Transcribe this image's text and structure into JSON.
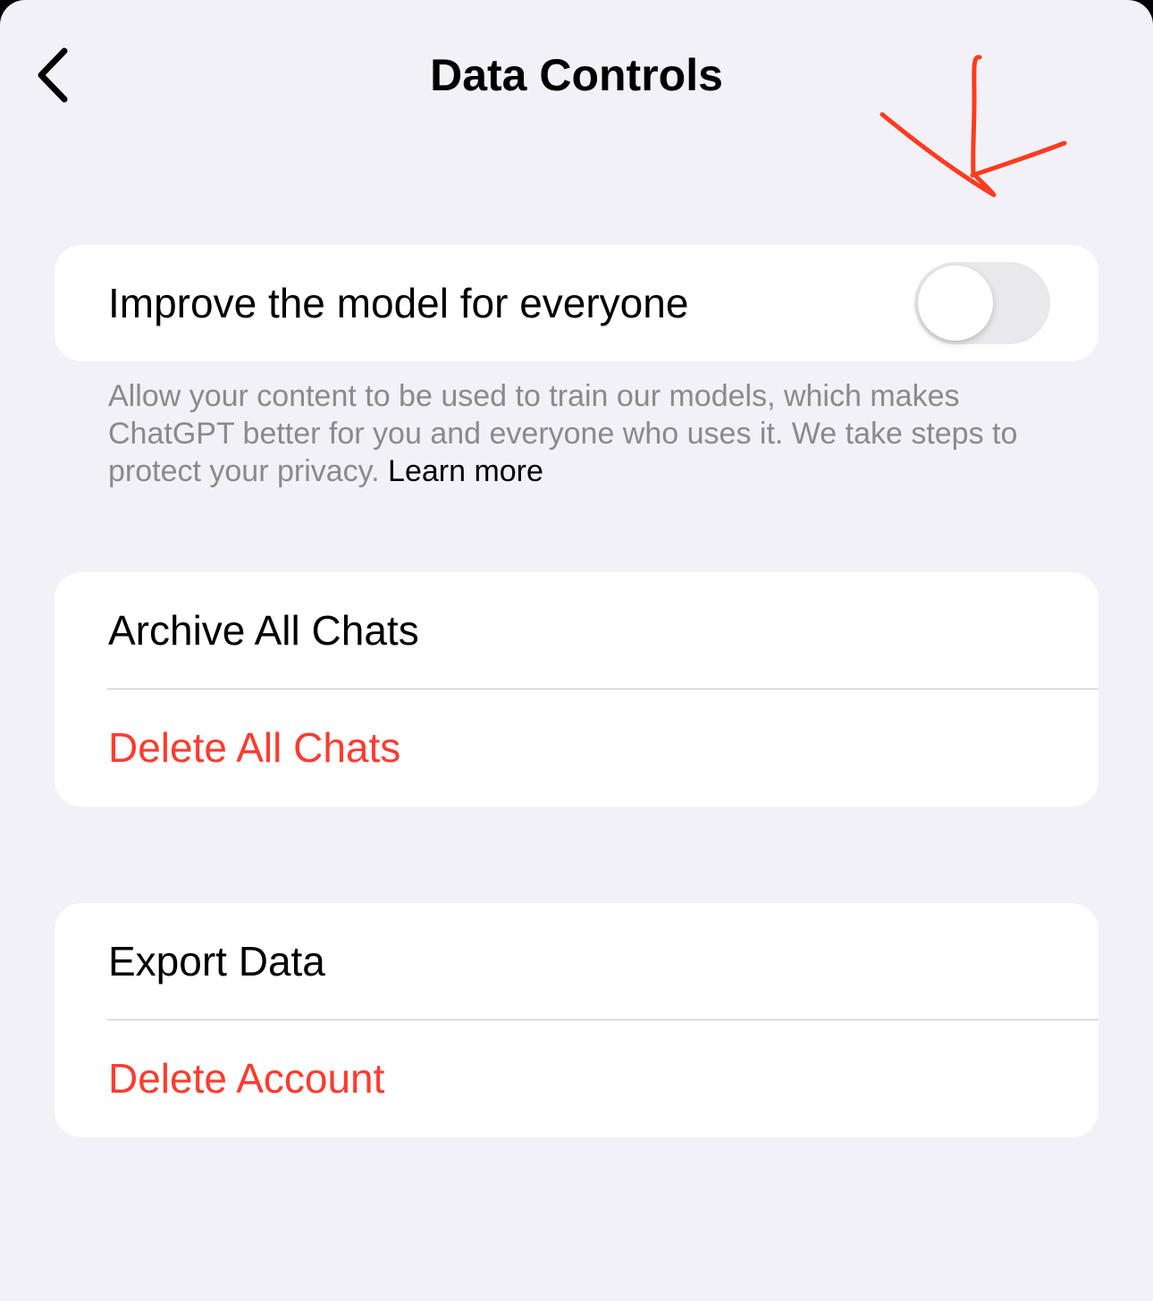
{
  "header": {
    "title": "Data Controls",
    "back_icon": "chevron-left-icon"
  },
  "improve_model": {
    "label": "Improve the model for everyone",
    "toggle_on": false,
    "description": "Allow your content to be used to train our models, which makes ChatGPT better for you and everyone who uses it. We take steps to protect your privacy.",
    "link_label": "Learn more"
  },
  "chats_section": {
    "archive_label": "Archive All Chats",
    "delete_label": "Delete All Chats"
  },
  "account_section": {
    "export_label": "Export Data",
    "delete_label": "Delete Account"
  },
  "colors": {
    "background": "#f2f1f7",
    "card": "#ffffff",
    "destructive": "#ff3b30",
    "secondary_text": "#8a8a8e",
    "toggle_off": "#e9e9eb",
    "annotation": "#ff3b1f"
  },
  "annotation": {
    "type": "hand-drawn-arrow",
    "icon": "arrow-down-annotation-icon"
  }
}
